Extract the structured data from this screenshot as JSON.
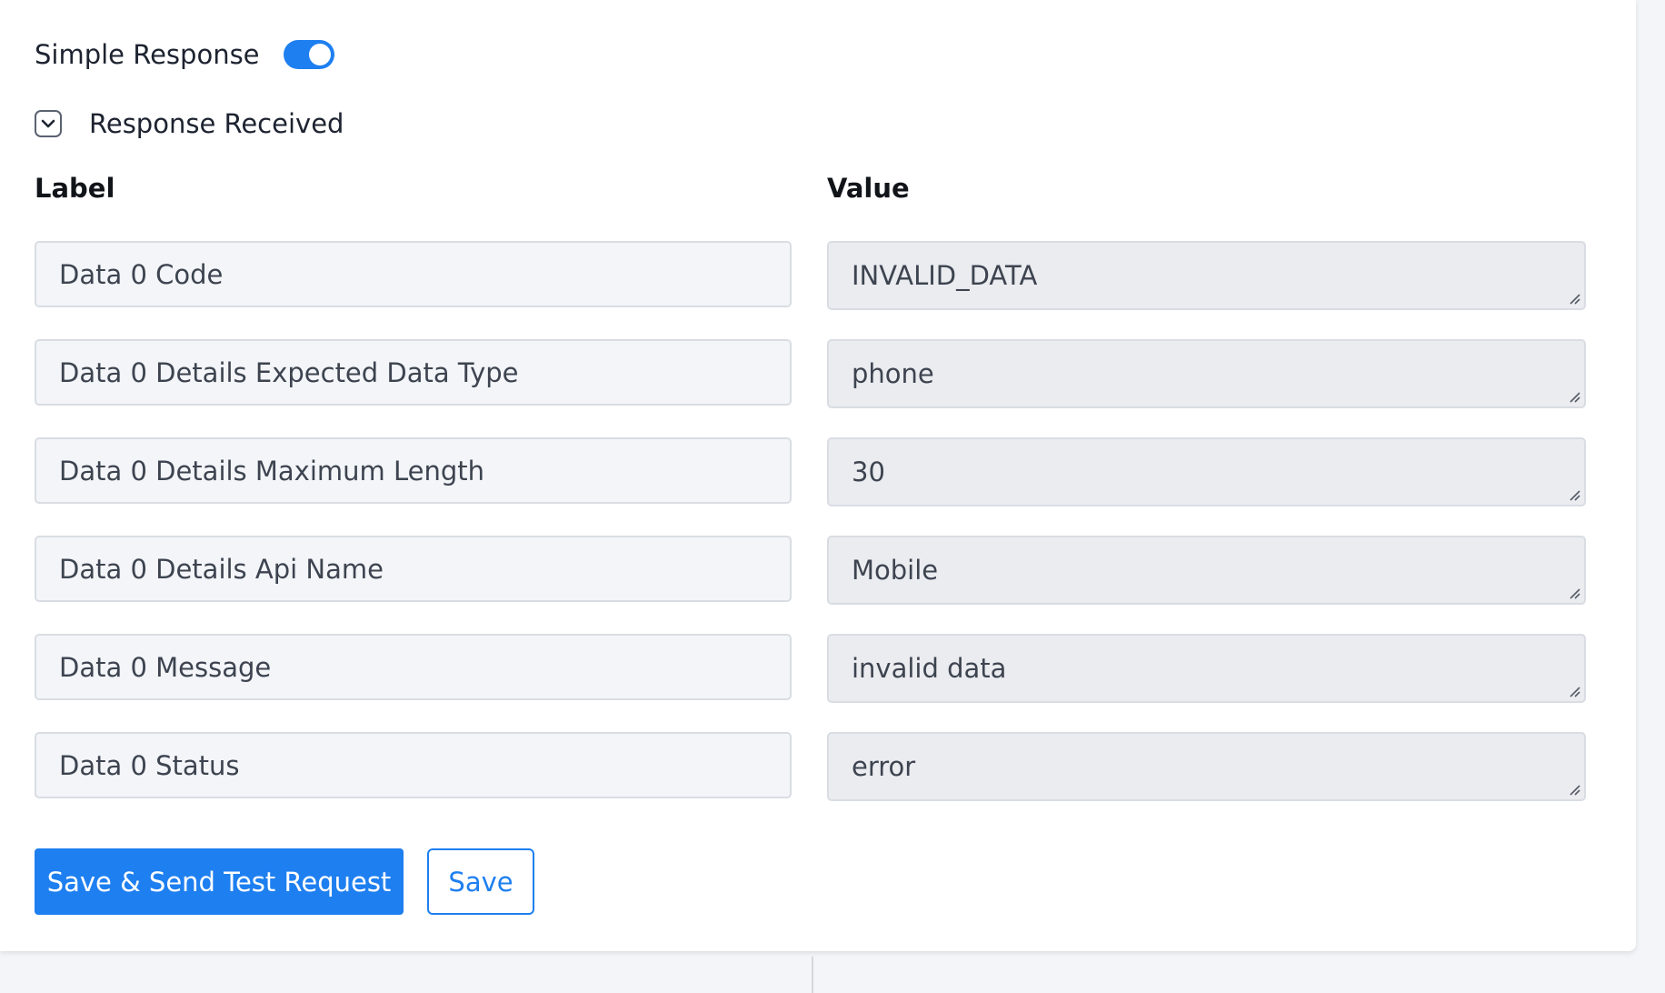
{
  "simple_response": {
    "label": "Simple Response",
    "enabled": true
  },
  "response_received": {
    "label": "Response Received",
    "expanded": true
  },
  "columns": {
    "label_header": "Label",
    "value_header": "Value"
  },
  "rows": [
    {
      "label": "Data 0 Code",
      "value": "INVALID_DATA"
    },
    {
      "label": "Data 0 Details Expected Data Type",
      "value": "phone"
    },
    {
      "label": "Data 0 Details Maximum Length",
      "value": "30"
    },
    {
      "label": "Data 0 Details Api Name",
      "value": "Mobile"
    },
    {
      "label": "Data 0 Message",
      "value": "invalid data"
    },
    {
      "label": "Data 0 Status",
      "value": "error"
    }
  ],
  "buttons": {
    "save_and_send": "Save & Send Test Request",
    "save": "Save"
  },
  "colors": {
    "accent": "#1e7ff0",
    "label_field_bg": "#f3f5f8",
    "value_field_bg": "#ebecf0"
  },
  "icons": {
    "collapse": "chevron-down-icon",
    "resize": "resize-grip-icon"
  }
}
